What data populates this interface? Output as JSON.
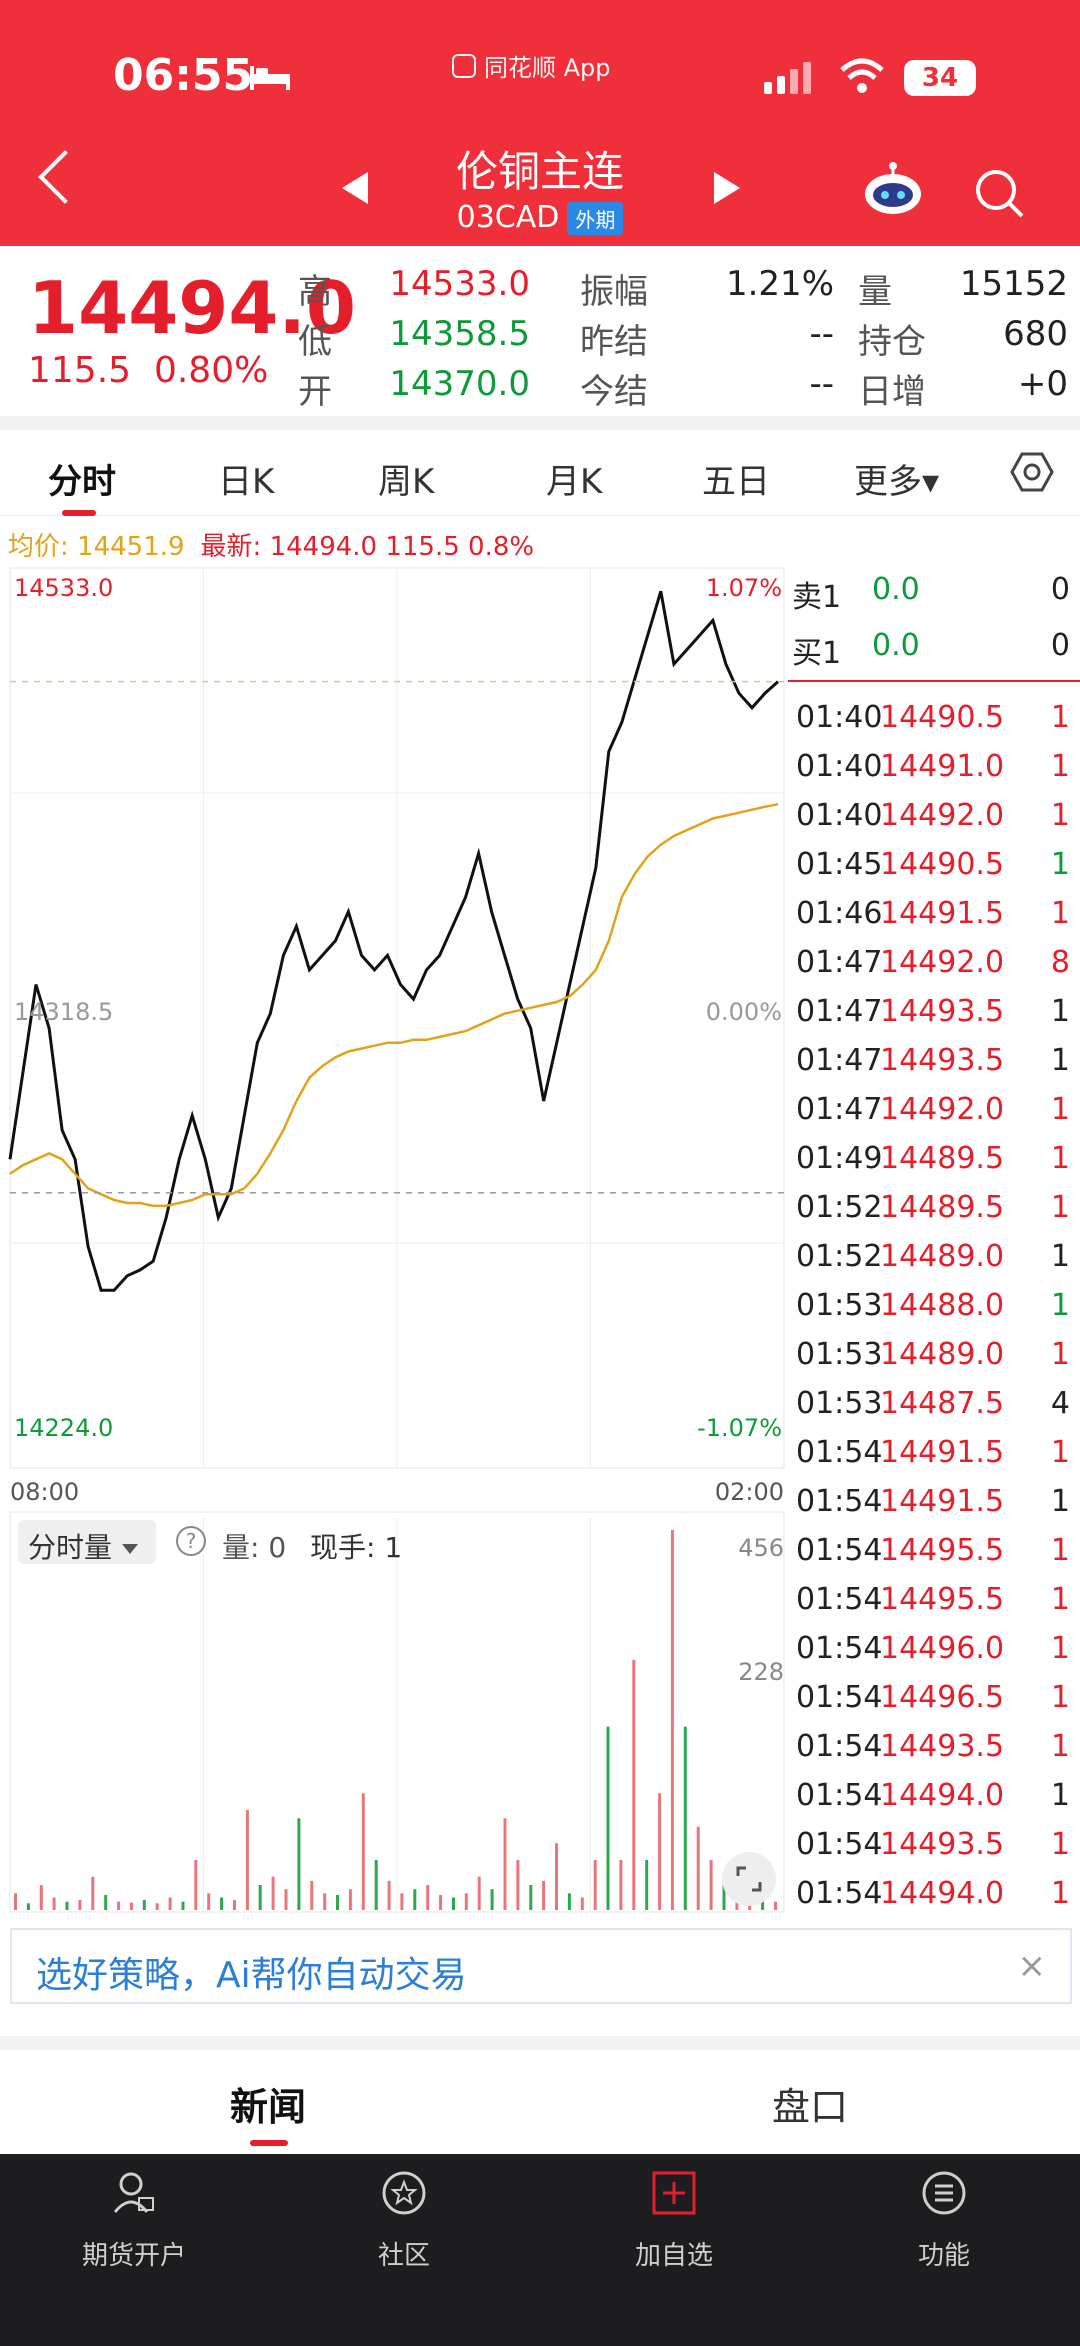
{
  "status_bar": {
    "time": "06:55",
    "app_label": "同花顺 App",
    "battery": "34"
  },
  "header": {
    "title": "伦铜主连",
    "code": "03CAD",
    "tag": "外期"
  },
  "quote": {
    "last_price": "14494.0",
    "change": "115.5",
    "change_pct": "0.80%",
    "rows": [
      {
        "l1": "高",
        "v1": "14533.0",
        "l2": "振幅",
        "v2": "1.21%",
        "l3": "量",
        "v3": "15152"
      },
      {
        "l1": "低",
        "v1": "14358.5",
        "l2": "昨结",
        "v2": "--",
        "l3": "持仓",
        "v3": "680"
      },
      {
        "l1": "开",
        "v1": "14370.0",
        "l2": "今结",
        "v2": "--",
        "l3": "日增",
        "v3": "+0"
      }
    ]
  },
  "tabs": {
    "t1": "分时",
    "t2": "日K",
    "t3": "周K",
    "t4": "月K",
    "t5": "五日",
    "t6": "更多▾"
  },
  "avg_line": {
    "avg": "均价: 14451.9",
    "latest": "最新: 14494.0   115.5   0.8%"
  },
  "chart_data": {
    "type": "line",
    "y_max_label": "14533.0",
    "y_mid_label": "14318.5",
    "y_min_label": "14224.0",
    "pct_max_label": "1.07%",
    "pct_mid_label": "0.00%",
    "pct_min_label": "-1.07%",
    "x_start_label": "08:00",
    "x_end_label": "02:00",
    "ylim": [
      14224.0,
      14533.0
    ],
    "prev_settle": 14318.5,
    "series": [
      {
        "name": "price",
        "color": "#111111",
        "values": [
          14330,
          14360,
          14390,
          14375,
          14340,
          14330,
          14300,
          14285,
          14285,
          14290,
          14292,
          14295,
          14310,
          14330,
          14345,
          14330,
          14310,
          14320,
          14345,
          14370,
          14380,
          14400,
          14410,
          14395,
          14400,
          14405,
          14415,
          14400,
          14395,
          14400,
          14390,
          14385,
          14395,
          14400,
          14410,
          14420,
          14435,
          14415,
          14400,
          14385,
          14375,
          14350,
          14370,
          14390,
          14410,
          14430,
          14470,
          14480,
          14495,
          14510,
          14525,
          14500,
          14505,
          14510,
          14515,
          14500,
          14490,
          14485,
          14490,
          14494
        ]
      },
      {
        "name": "avg",
        "color": "#e3a21a",
        "values": [
          14325,
          14328,
          14330,
          14332,
          14330,
          14325,
          14320,
          14318,
          14316,
          14315,
          14315,
          14314,
          14314,
          14315,
          14316,
          14318,
          14318,
          14318,
          14320,
          14325,
          14332,
          14340,
          14350,
          14358,
          14362,
          14365,
          14367,
          14368,
          14369,
          14370,
          14370,
          14371,
          14371,
          14372,
          14373,
          14374,
          14376,
          14378,
          14380,
          14381,
          14382,
          14383,
          14384,
          14386,
          14390,
          14395,
          14405,
          14420,
          14428,
          14434,
          14438,
          14441,
          14443,
          14445,
          14447,
          14448,
          14449,
          14450,
          14451,
          14451.9
        ]
      }
    ],
    "volume": {
      "max_label": "456",
      "mid_label": "228",
      "max": 456,
      "values": [
        20,
        8,
        30,
        15,
        10,
        12,
        40,
        18,
        10,
        9,
        12,
        8,
        15,
        10,
        60,
        20,
        15,
        12,
        120,
        30,
        40,
        25,
        110,
        35,
        20,
        18,
        25,
        140,
        60,
        35,
        20,
        25,
        30,
        18,
        15,
        20,
        40,
        25,
        110,
        60,
        30,
        35,
        80,
        20,
        15,
        60,
        220,
        60,
        300,
        60,
        140,
        456,
        220,
        100,
        60,
        30,
        20,
        15,
        12,
        10
      ]
    }
  },
  "orderbook": {
    "ask": {
      "label": "卖1",
      "price": "0.0",
      "vol": "0"
    },
    "bid": {
      "label": "买1",
      "price": "0.0",
      "vol": "0"
    }
  },
  "ticks": [
    {
      "time": "01:40",
      "price": "14490.5",
      "vol": "1",
      "dir": "red"
    },
    {
      "time": "01:40",
      "price": "14491.0",
      "vol": "1",
      "dir": "red"
    },
    {
      "time": "01:40",
      "price": "14492.0",
      "vol": "1",
      "dir": "red"
    },
    {
      "time": "01:45",
      "price": "14490.5",
      "vol": "1",
      "dir": "green"
    },
    {
      "time": "01:46",
      "price": "14491.5",
      "vol": "1",
      "dir": "red"
    },
    {
      "time": "01:47",
      "price": "14492.0",
      "vol": "8",
      "dir": "red"
    },
    {
      "time": "01:47",
      "price": "14493.5",
      "vol": "1",
      "dir": "black"
    },
    {
      "time": "01:47",
      "price": "14493.5",
      "vol": "1",
      "dir": "black"
    },
    {
      "time": "01:47",
      "price": "14492.0",
      "vol": "1",
      "dir": "red"
    },
    {
      "time": "01:49",
      "price": "14489.5",
      "vol": "1",
      "dir": "red"
    },
    {
      "time": "01:52",
      "price": "14489.5",
      "vol": "1",
      "dir": "red"
    },
    {
      "time": "01:52",
      "price": "14489.0",
      "vol": "1",
      "dir": "black"
    },
    {
      "time": "01:53",
      "price": "14488.0",
      "vol": "1",
      "dir": "green"
    },
    {
      "time": "01:53",
      "price": "14489.0",
      "vol": "1",
      "dir": "red"
    },
    {
      "time": "01:53",
      "price": "14487.5",
      "vol": "4",
      "dir": "black"
    },
    {
      "time": "01:54",
      "price": "14491.5",
      "vol": "1",
      "dir": "red"
    },
    {
      "time": "01:54",
      "price": "14491.5",
      "vol": "1",
      "dir": "black"
    },
    {
      "time": "01:54",
      "price": "14495.5",
      "vol": "1",
      "dir": "red"
    },
    {
      "time": "01:54",
      "price": "14495.5",
      "vol": "1",
      "dir": "red"
    },
    {
      "time": "01:54",
      "price": "14496.0",
      "vol": "1",
      "dir": "red"
    },
    {
      "time": "01:54",
      "price": "14496.5",
      "vol": "1",
      "dir": "red"
    },
    {
      "time": "01:54",
      "price": "14493.5",
      "vol": "1",
      "dir": "red"
    },
    {
      "time": "01:54",
      "price": "14494.0",
      "vol": "1",
      "dir": "black"
    },
    {
      "time": "01:54",
      "price": "14493.5",
      "vol": "1",
      "dir": "red"
    },
    {
      "time": "01:54",
      "price": "14494.0",
      "vol": "1",
      "dir": "red"
    }
  ],
  "vol_header": {
    "select": "分时量",
    "help": "?",
    "label": "量: 0",
    "hand": "现手: 1"
  },
  "banner": {
    "text": "选好策略，Ai帮你自动交易",
    "close": "×"
  },
  "news_tabs": {
    "news": "新闻",
    "panel": "盘口"
  },
  "nav": {
    "n1": "期货开户",
    "n2": "社区",
    "n3": "加自选",
    "n4": "功能"
  }
}
